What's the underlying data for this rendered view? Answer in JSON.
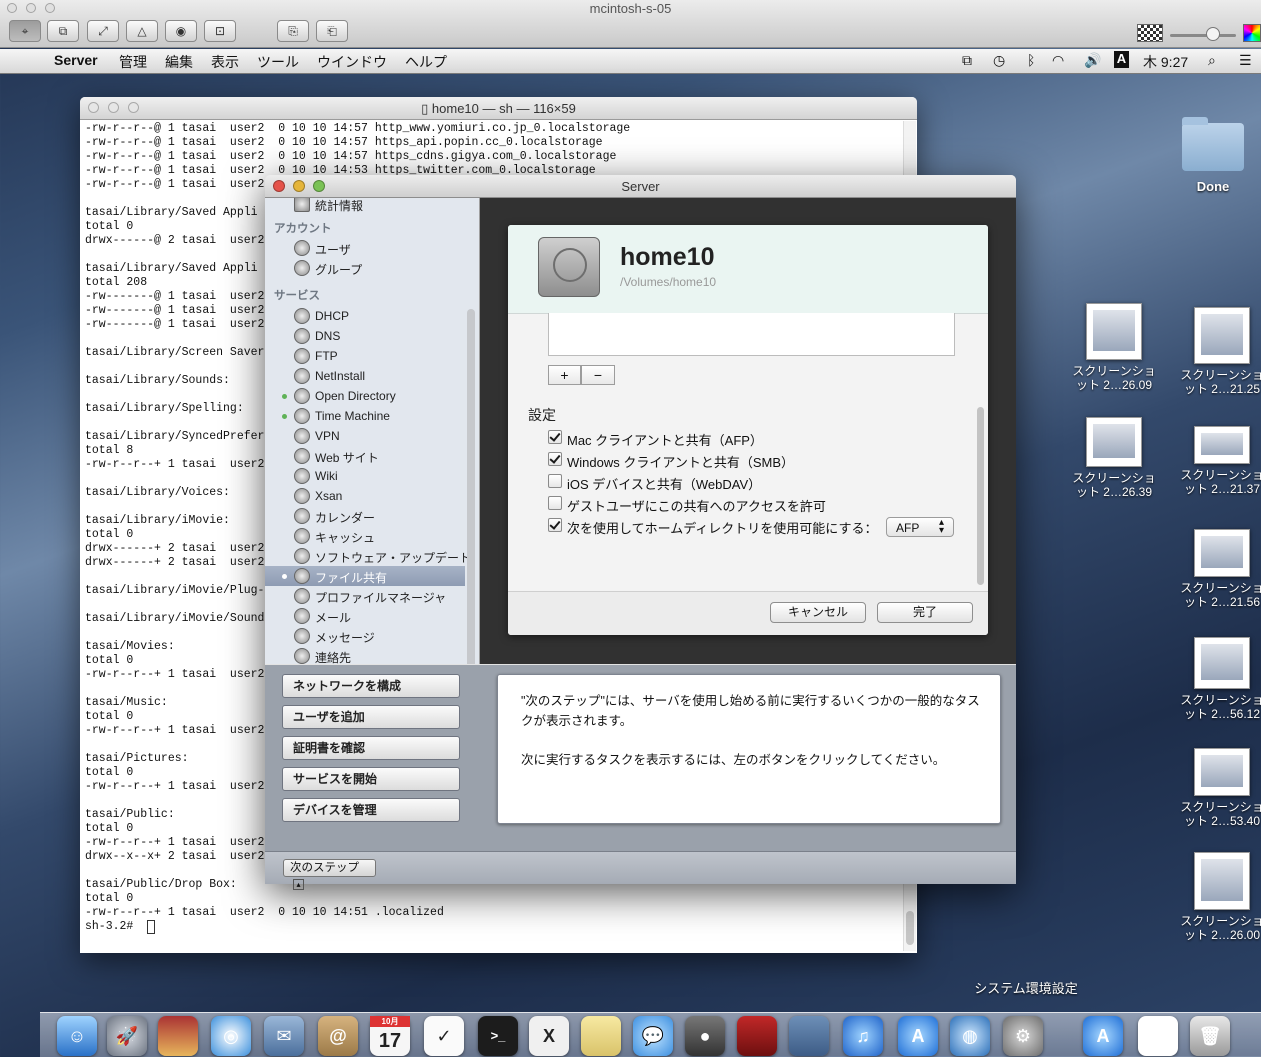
{
  "remote": {
    "title": "mcintosh-s-05"
  },
  "menubar": {
    "apple": "",
    "items": [
      "Server",
      "管理",
      "編集",
      "表示",
      "ツール",
      "ウインドウ",
      "ヘルプ"
    ],
    "clock": "木 9:27",
    "input_mode": "A"
  },
  "terminal": {
    "title": "home10 — sh — 116×59",
    "lines": [
      "-rw-r--r--@ 1 tasai  user2  0 10 10 14:57 http_www.yomiuri.co.jp_0.localstorage",
      "-rw-r--r--@ 1 tasai  user2  0 10 10 14:57 https_api.popin.cc_0.localstorage",
      "-rw-r--r--@ 1 tasai  user2  0 10 10 14:57 https_cdns.gigya.com_0.localstorage",
      "-rw-r--r--@ 1 tasai  user2  0 10 10 14:53 https_twitter.com_0.localstorage",
      "-rw-r--r--@ 1 tasai  user2",
      "",
      "tasai/Library/Saved Appli",
      "total 0",
      "drwx------@ 2 tasai  user2",
      "",
      "tasai/Library/Saved Appli",
      "total 208",
      "-rw-------@ 1 tasai  user2",
      "-rw-------@ 1 tasai  user2",
      "-rw-------@ 1 tasai  user2",
      "",
      "tasai/Library/Screen Saver",
      "",
      "tasai/Library/Sounds:",
      "",
      "tasai/Library/Spelling:",
      "",
      "tasai/Library/SyncedPrefer",
      "total 8",
      "-rw-r--r--+ 1 tasai  user2",
      "",
      "tasai/Library/Voices:",
      "",
      "tasai/Library/iMovie:",
      "total 0",
      "drwx------+ 2 tasai  user2",
      "drwx------+ 2 tasai  user2",
      "",
      "tasai/Library/iMovie/Plug-",
      "",
      "tasai/Library/iMovie/Sound",
      "",
      "tasai/Movies:",
      "total 0",
      "-rw-r--r--+ 1 tasai  user2",
      "",
      "tasai/Music:",
      "total 0",
      "-rw-r--r--+ 1 tasai  user2",
      "",
      "tasai/Pictures:",
      "total 0",
      "-rw-r--r--+ 1 tasai  user2",
      "",
      "tasai/Public:",
      "total 0",
      "-rw-r--r--+ 1 tasai  user2",
      "drwx--x--x+ 2 tasai  user2",
      "",
      "tasai/Public/Drop Box:",
      "total 0",
      "-rw-r--r--+ 1 tasai  user2  0 10 10 14:51 .localized",
      "sh-3.2# "
    ]
  },
  "server": {
    "title": "Server",
    "sidebar": {
      "top_item": "統計情報",
      "account_header": "アカウント",
      "accounts": [
        "ユーザ",
        "グループ"
      ],
      "services_header": "サービス",
      "services": [
        {
          "label": "DHCP",
          "status": false
        },
        {
          "label": "DNS",
          "status": false
        },
        {
          "label": "FTP",
          "status": false
        },
        {
          "label": "NetInstall",
          "status": false
        },
        {
          "label": "Open Directory",
          "status": true
        },
        {
          "label": "Time Machine",
          "status": true
        },
        {
          "label": "VPN",
          "status": false
        },
        {
          "label": "Web サイト",
          "status": false
        },
        {
          "label": "Wiki",
          "status": false
        },
        {
          "label": "Xsan",
          "status": false
        },
        {
          "label": "カレンダー",
          "status": false
        },
        {
          "label": "キャッシュ",
          "status": false
        },
        {
          "label": "ソフトウェア・アップデート",
          "status": false
        },
        {
          "label": "ファイル共有",
          "status": true,
          "selected": true
        },
        {
          "label": "プロファイルマネージャ",
          "status": false
        },
        {
          "label": "メール",
          "status": false
        },
        {
          "label": "メッセージ",
          "status": false
        },
        {
          "label": "連絡先",
          "status": false
        }
      ]
    },
    "sheet": {
      "volume_name": "home10",
      "volume_path": "/Volumes/home10",
      "plus": "+",
      "minus": "−",
      "settings_label": "設定",
      "options": [
        {
          "label": "Mac クライアントと共有（AFP）",
          "checked": true
        },
        {
          "label": "Windows クライアントと共有（SMB）",
          "checked": true
        },
        {
          "label": "iOS デバイスと共有（WebDAV）",
          "checked": false
        },
        {
          "label": "ゲストユーザにこの共有へのアクセスを許可",
          "checked": false
        },
        {
          "label": "次を使用してホームディレクトリを使用可能にする：",
          "checked": true
        }
      ],
      "protocol_value": "AFP",
      "cancel": "キャンセル",
      "done": "完了"
    },
    "next_buttons": [
      "ネットワークを構成",
      "ユーザを追加",
      "証明書を確認",
      "サービスを開始",
      "デバイスを管理"
    ],
    "next_text_1": "\"次のステップ\"には、サーバを使用し始める前に実行するいくつかの一般的なタスクが表示されます。",
    "next_text_2": "次に実行するタスクを表示するには、左のボタンをクリックしてください。",
    "next_step_label": "次のステップ"
  },
  "desktop": {
    "folder_label": "Done",
    "screenshots": [
      {
        "label": "スクリーンショ\nット 2…26.09"
      },
      {
        "label": "スクリーンショ\nット 2…21.25"
      },
      {
        "label": "スクリーンショ\nット 2…26.39"
      },
      {
        "label": "スクリーンショ\nット 2…21.37"
      },
      {
        "label": "スクリーンショ\nット 2…21.56"
      },
      {
        "label": "スクリーンショ\nット 2…56.12"
      },
      {
        "label": "スクリーンショ\nット 2…53.40"
      },
      {
        "label": "スクリーンショ\nット 2…26.00"
      }
    ]
  },
  "dock": {
    "tooltip": "システム環境設定",
    "calendar_day": "17",
    "calendar_month": "10月",
    "apps": [
      "finder-icon",
      "launchpad-icon",
      "photo-booth-icon",
      "safari-icon",
      "mail-icon",
      "contacts-icon",
      "calendar-icon",
      "reminders-icon",
      "terminal-icon",
      "x11-icon",
      "notes-icon",
      "messages-icon",
      "facetime-icon",
      "photo-booth-red-icon",
      "iphoto-icon",
      "itunes-icon",
      "app-store-icon",
      "server-globe-icon",
      "system-preferences-icon",
      "app-store-2-icon",
      "preview-icon",
      "trash-icon"
    ]
  }
}
